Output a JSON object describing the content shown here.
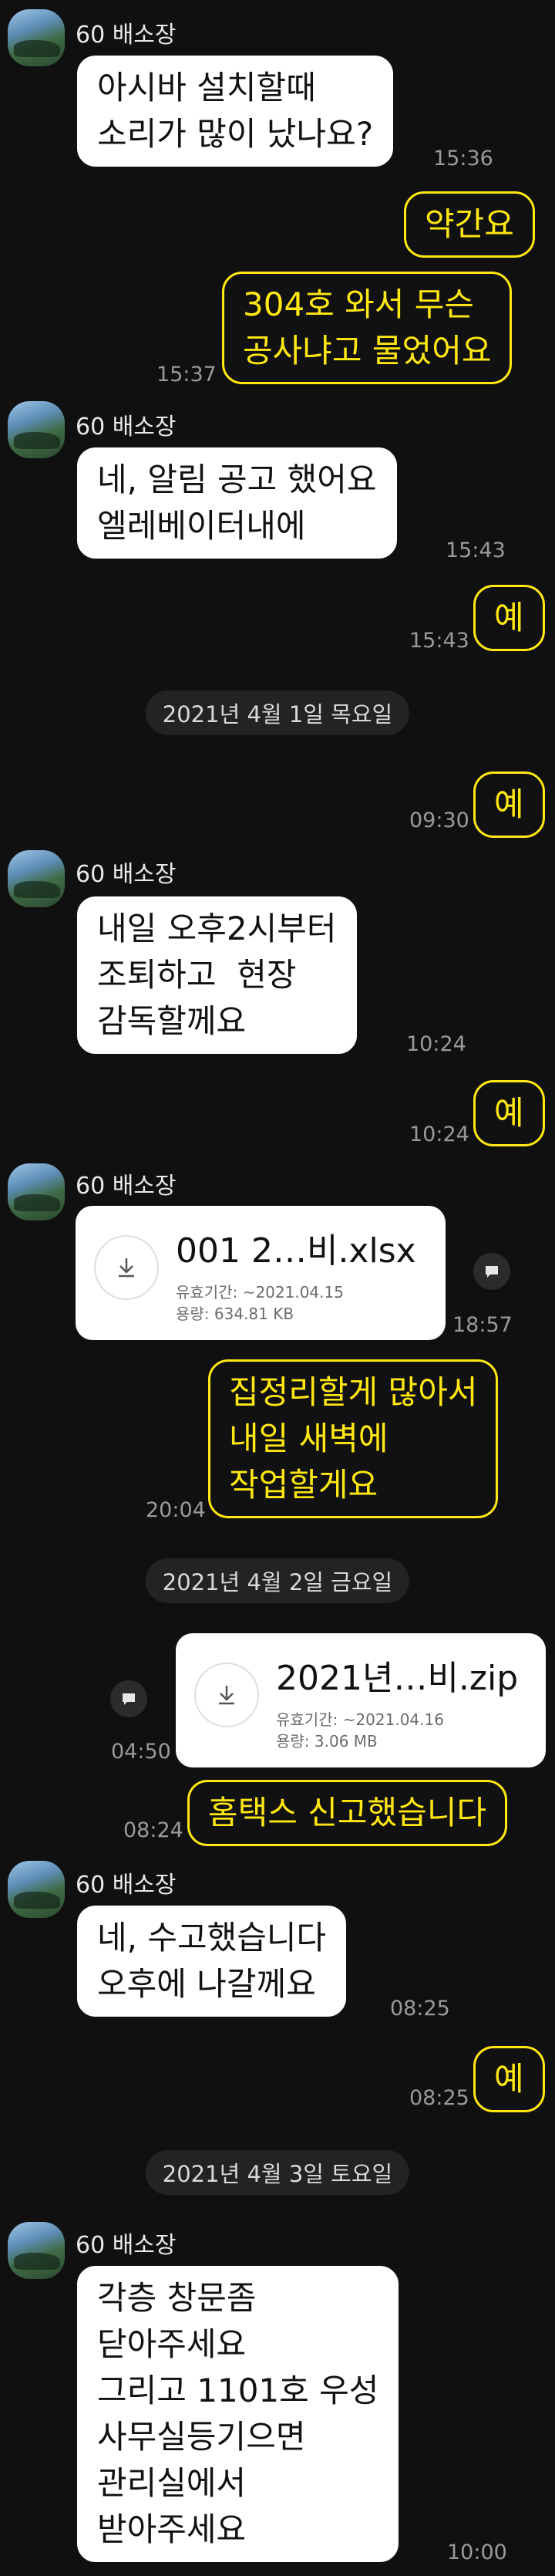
{
  "contact": {
    "name": "60 배소장"
  },
  "messages": [
    {
      "id": "m1",
      "text": "아시바 설치할때\n소리가 많이 났나요?",
      "time": "15:36"
    },
    {
      "id": "m2",
      "text": "약간요",
      "time": ""
    },
    {
      "id": "m3",
      "text": "304호 와서 무슨\n공사냐고 물었어요",
      "time": "15:37"
    },
    {
      "id": "m4",
      "text": "네, 알림 공고 했어요\n엘레베이터내에",
      "time": "15:43"
    },
    {
      "id": "m5",
      "text": "예",
      "time": "15:43"
    },
    {
      "id": "m6",
      "text": "예",
      "time": "09:30"
    },
    {
      "id": "m7",
      "text": "내일 오후2시부터\n조퇴하고  현장\n감독할께요",
      "time": "10:24"
    },
    {
      "id": "m8",
      "text": "예",
      "time": "10:24"
    },
    {
      "id": "m9",
      "time": "18:57"
    },
    {
      "id": "m10",
      "text": "집정리할게 많아서\n내일 새벽에\n작업할게요",
      "time": "20:04"
    },
    {
      "id": "m11",
      "time": "04:50"
    },
    {
      "id": "m12",
      "text": "홈택스 신고했습니다",
      "time": "08:24"
    },
    {
      "id": "m13",
      "text": "네, 수고했습니다\n오후에 나갈께요",
      "time": "08:25"
    },
    {
      "id": "m14",
      "text": "예",
      "time": "08:25"
    },
    {
      "id": "m15",
      "text": "각층 창문좀\n닫아주세요\n그리고 1101호 우성\n사무실등기으면\n관리실에서\n받아주세요",
      "time": "10:00"
    }
  ],
  "dates": {
    "d1": "2021년 4월 1일 목요일",
    "d2": "2021년 4월 2일 금요일",
    "d3": "2021년 4월 3일 토요일"
  },
  "files": {
    "f1": {
      "name": "001 2…비.xlsx",
      "expiry": "유효기간: ~2021.04.15",
      "size": "용량: 634.81 KB"
    },
    "f2": {
      "name": "2021년…비.zip",
      "expiry": "유효기간: ~2021.04.16",
      "size": "용량: 3.06 MB"
    }
  },
  "icons": {
    "download": "download-icon",
    "share": "share-icon",
    "avatar": "profile-avatar"
  },
  "colors": {
    "background": "#101010",
    "outgoing_text": "#ffe812",
    "incoming_bubble": "#ffffff",
    "timestamp": "#9a9a9a"
  }
}
